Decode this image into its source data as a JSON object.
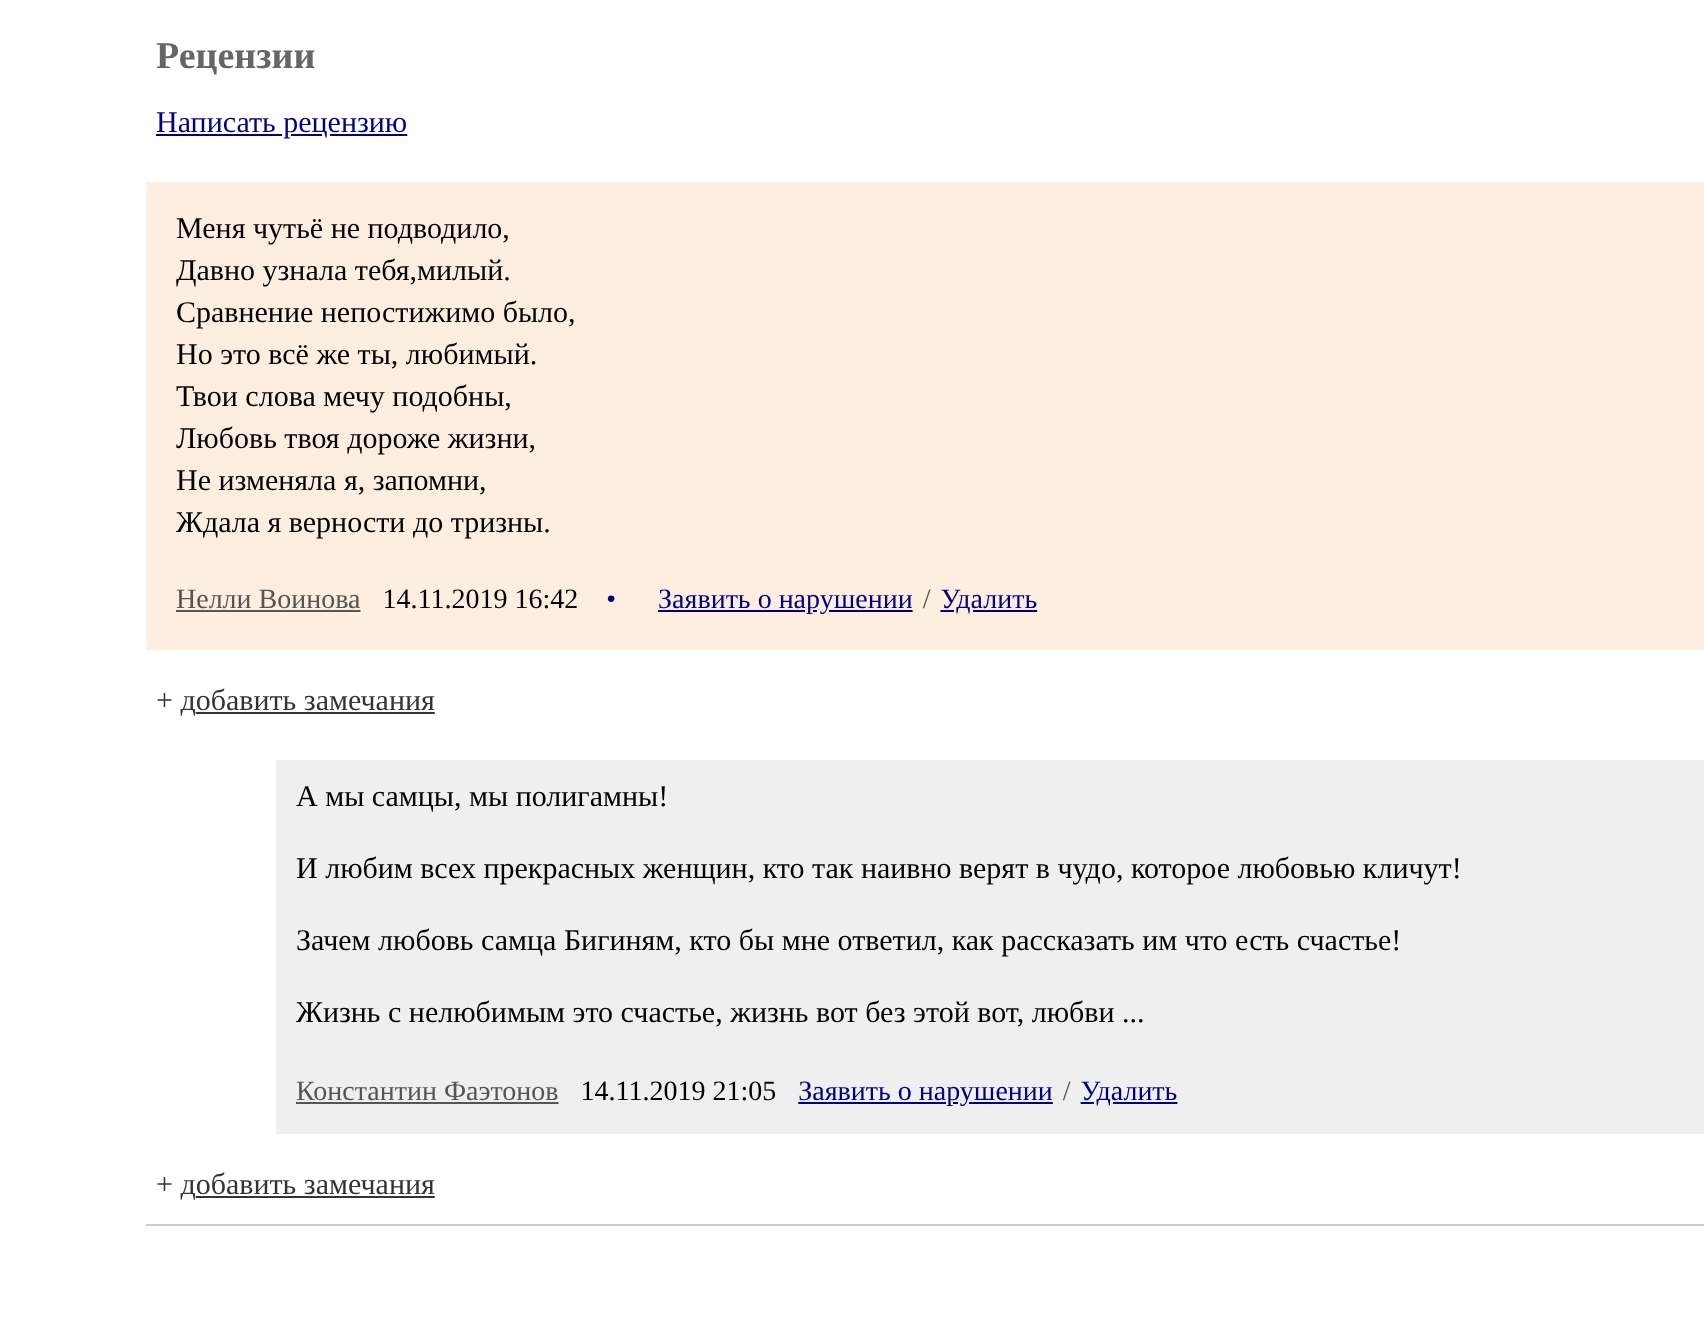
{
  "heading": "Рецензии",
  "write_link": "Написать рецензию",
  "reviews": [
    {
      "kind": "review",
      "lines": [
        "Меня чутьё не подводило,",
        "Давно узнала тебя,милый.",
        "Сравнение непостижимо было,",
        "Но это всё же ты, любимый.",
        "Твои слова мечу подобны,",
        "Любовь твоя дороже жизни,",
        "Не изменяла я, запомни,",
        "Ждала я верности до тризны."
      ],
      "author": "Нелли Воинова",
      "date": "14.11.2019 16:42",
      "separator": "•",
      "report": "Заявить о нарушении",
      "slash": "/",
      "delete": "Удалить",
      "add_plus": "+ д",
      "add_link": "обавить замечания"
    },
    {
      "kind": "reply",
      "paragraphs": [
        "А мы самцы, мы полигамны!",
        "И любим всех прекрасных женщин, кто так наивно верят в чудо, которое любовью кличут!",
        "Зачем любовь самца Бигиням, кто бы мне ответил, как рассказать им что есть счастье!",
        "Жизнь с нелюбимым это счастье, жизнь вот без этой вот, любви ..."
      ],
      "author": "Константин Фаэтонов",
      "date": "14.11.2019 21:05",
      "report": "Заявить о нарушении",
      "slash": "/",
      "delete": "Удалить",
      "add_plus": "+ д",
      "add_link": "обавить замечания"
    }
  ]
}
